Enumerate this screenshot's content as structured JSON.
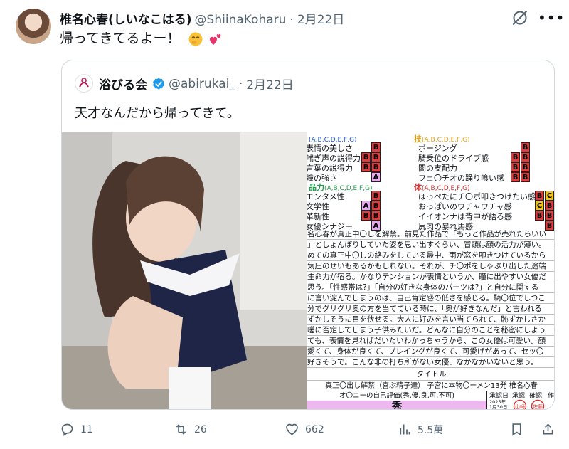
{
  "post": {
    "author_name": "椎名心春(しいなこはる)",
    "handle": "@ShiinaKoharu",
    "separator": "·",
    "date": "2月22日",
    "text": "帰ってきてるよー！",
    "emojis": [
      "hugging-face",
      "two-hearts"
    ]
  },
  "quote": {
    "author_name": "浴びる会",
    "handle": "@abirukai_",
    "separator": "·",
    "date": "2月22日",
    "text": "天才なんだから帰ってきて。"
  },
  "sheet": {
    "sections": [
      {
        "title": "",
        "scale": "(A,B,C,D,E,F,G)",
        "color": "#1a56d6"
      },
      {
        "title": "技",
        "scale": "(A,B,C,D,E,F,G)",
        "color": "#e8a317"
      },
      {
        "title": "品力",
        "scale": "(A,B,C,D,E,F,G)",
        "color": "#1e9e4a"
      },
      {
        "title": "体",
        "scale": "(A,B,C,D,E,F,G)",
        "color": "#d32f2f"
      }
    ],
    "left_rows": [
      {
        "label": "表情の美しさ",
        "grades": [
          "B"
        ]
      },
      {
        "label": "喘ぎ声の説得力",
        "grades": [
          "B",
          "B"
        ]
      },
      {
        "label": "言葉の説得力",
        "grades": [
          "B",
          "B"
        ]
      },
      {
        "label": "瞳の強さ",
        "grades": [
          "A"
        ]
      },
      {
        "label": "エンタメ性",
        "grades": [
          "B"
        ]
      },
      {
        "label": "文学性",
        "grades": [
          "A",
          "B"
        ]
      },
      {
        "label": "革新性",
        "grades": [
          "B",
          "B"
        ]
      },
      {
        "label": "女優シナジー",
        "grades": [
          "A"
        ]
      }
    ],
    "right_rows": [
      {
        "label": "ポージング",
        "grades": [
          "B"
        ]
      },
      {
        "label": "騎乗位のドライブ感",
        "grades": [
          "B",
          "B"
        ]
      },
      {
        "label": "闇の支配力",
        "grades": [
          "B",
          "B"
        ]
      },
      {
        "label": "フェ〇チオの踊り喰い感",
        "grades": [
          "B",
          "B"
        ]
      },
      {
        "label": "ほっぺたにチ〇ポ叩きつけたい感",
        "grades": [
          "B",
          "C"
        ]
      },
      {
        "label": "おっぱいのワチャワチャ感",
        "grades": [
          "C",
          "B"
        ]
      },
      {
        "label": "イイオンナは背中が語る感",
        "grades": [
          "B",
          "B"
        ]
      },
      {
        "label": "尻肉の暴れ馬感",
        "grades": [
          "B"
        ]
      }
    ],
    "review_lines": [
      "名心春が真正中〇しを解禁。前見た作品で「もっと作品が売れたらいい",
      "」としょんぼりしていた姿を思い出すぐらい、冒頭は顔の活力が薄い。",
      "めての真正中〇しの絡みをしている最中、雨が窓を叩きつけているから",
      "気圧のせいもあるかもしれない。それが、チ〇ポをしゃぶり出した途端",
      "生命力が宿る。かなりテンションが表情というか、瞳に出やすい女優だ",
      "思う。「性感帯は?」「自分の好きな身体のパーツは?」と自分に関する",
      "に言い淀んでしまうのは、自己肯定感の低さを感じる。騎〇位でしつこ",
      "分でグリグリ奥の方を当てている時に、「奥が好きなんだ」と言われる",
      "ずかしそうに目を伏せる。大人に好みを言い当てられて、恥ずかしさか",
      "嗟に否定してしまう子供みたいだ。どんなに自分のことを秘密にしよう",
      "ても、表情を見ればだいたいわかっちゃうから、この女優は可愛い。顔",
      "愛くて、身体が良くて、プレイングが良くて、可愛げがあって、セッ〇",
      "好きそうで。こんな非の打ち所がない女優、なかなかいないと思う。"
    ],
    "title_label": "タイトル",
    "title_value": "真正〇出し解禁（喜ぶ精子達） 子宮に本物〇ーメン13発 椎名心春",
    "self_eval_label": "オ〇ニーの自己評価(秀,優,良,可,不可)",
    "self_eval_value": "秀",
    "approval_headers": [
      "承認日",
      "承認",
      "確認",
      "作"
    ],
    "approval_date": "2025年\n1月30日",
    "stamp_text_1": "山崎",
    "stamp_text_2": "佐藤"
  },
  "actions": {
    "reply_count": "11",
    "repost_count": "26",
    "like_count": "662",
    "views_count": "5.5萬"
  },
  "colors": {
    "text_primary": "#0f1419",
    "text_secondary": "#536471",
    "verified_blue": "#1d9bf0",
    "grade_b_red": "#e23b3b",
    "grade_a_pink": "#e7a6ee",
    "grade_c_yellow": "#f0c419",
    "self_eval_bg": "#efb7ef"
  }
}
